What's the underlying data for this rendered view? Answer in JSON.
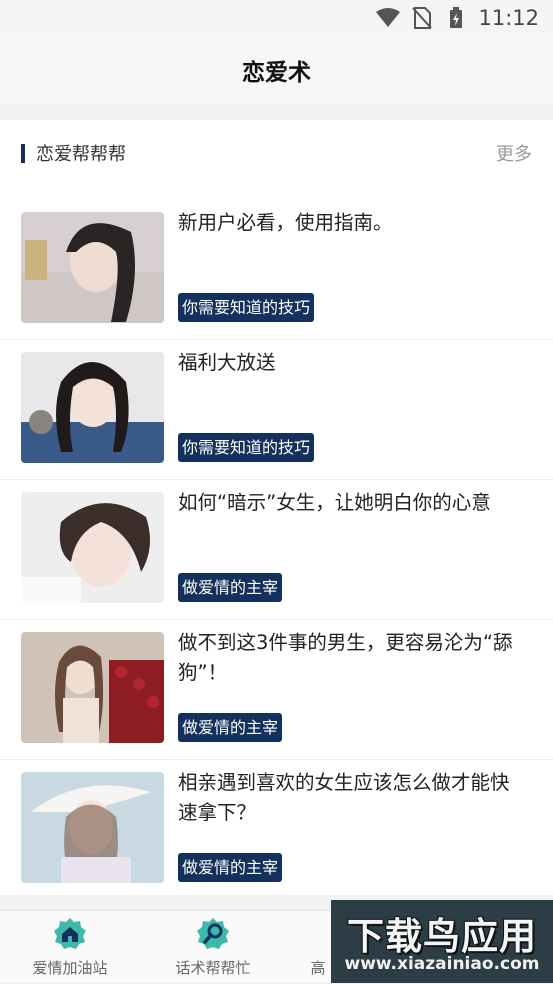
{
  "status_bar": {
    "time": "11:12"
  },
  "header": {
    "title": "恋爱术"
  },
  "section": {
    "title": "恋爱帮帮帮",
    "more": "更多"
  },
  "articles": [
    {
      "title": "新用户必看，使用指南。",
      "tag": "你需要知道的技巧"
    },
    {
      "title": "福利大放送",
      "tag": "你需要知道的技巧"
    },
    {
      "title": "如何“暗示”女生，让她明白你的心意",
      "tag": "做爱情的主宰"
    },
    {
      "title": "做不到这3件事的男生，更容易沦为“舔狗”！",
      "tag": "做爱情的主宰"
    },
    {
      "title": "相亲遇到喜欢的女生应该怎么做才能快速拿下？",
      "tag": "做爱情的主宰"
    }
  ],
  "tabs": [
    {
      "label": "爱情加油站",
      "icon": "home-icon"
    },
    {
      "label": "话术帮帮忙",
      "icon": "search-icon"
    },
    {
      "label": "高",
      "icon": "partial-icon"
    }
  ],
  "watermark": {
    "line1": "下载鸟应用",
    "line2": "www.xiazainiao.com"
  },
  "colors": {
    "accent": "#13315c",
    "tab_icon": "#3cb9a8"
  }
}
